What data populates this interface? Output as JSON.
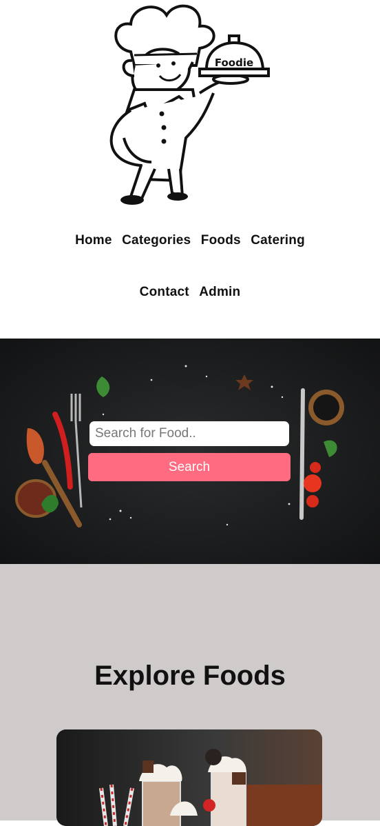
{
  "logo": {
    "badge_text": "Foodie"
  },
  "nav": {
    "row1": [
      "Home",
      "Categories",
      "Foods",
      "Catering"
    ],
    "row2": [
      "Contact",
      "Admin"
    ]
  },
  "search": {
    "placeholder": "Search for Food..",
    "button_label": "Search"
  },
  "explore": {
    "title": "Explore Foods"
  },
  "colors": {
    "accent": "#ff6b81",
    "explore_bg": "#cfcbcb",
    "hero_bg": "#1c1d1e"
  }
}
